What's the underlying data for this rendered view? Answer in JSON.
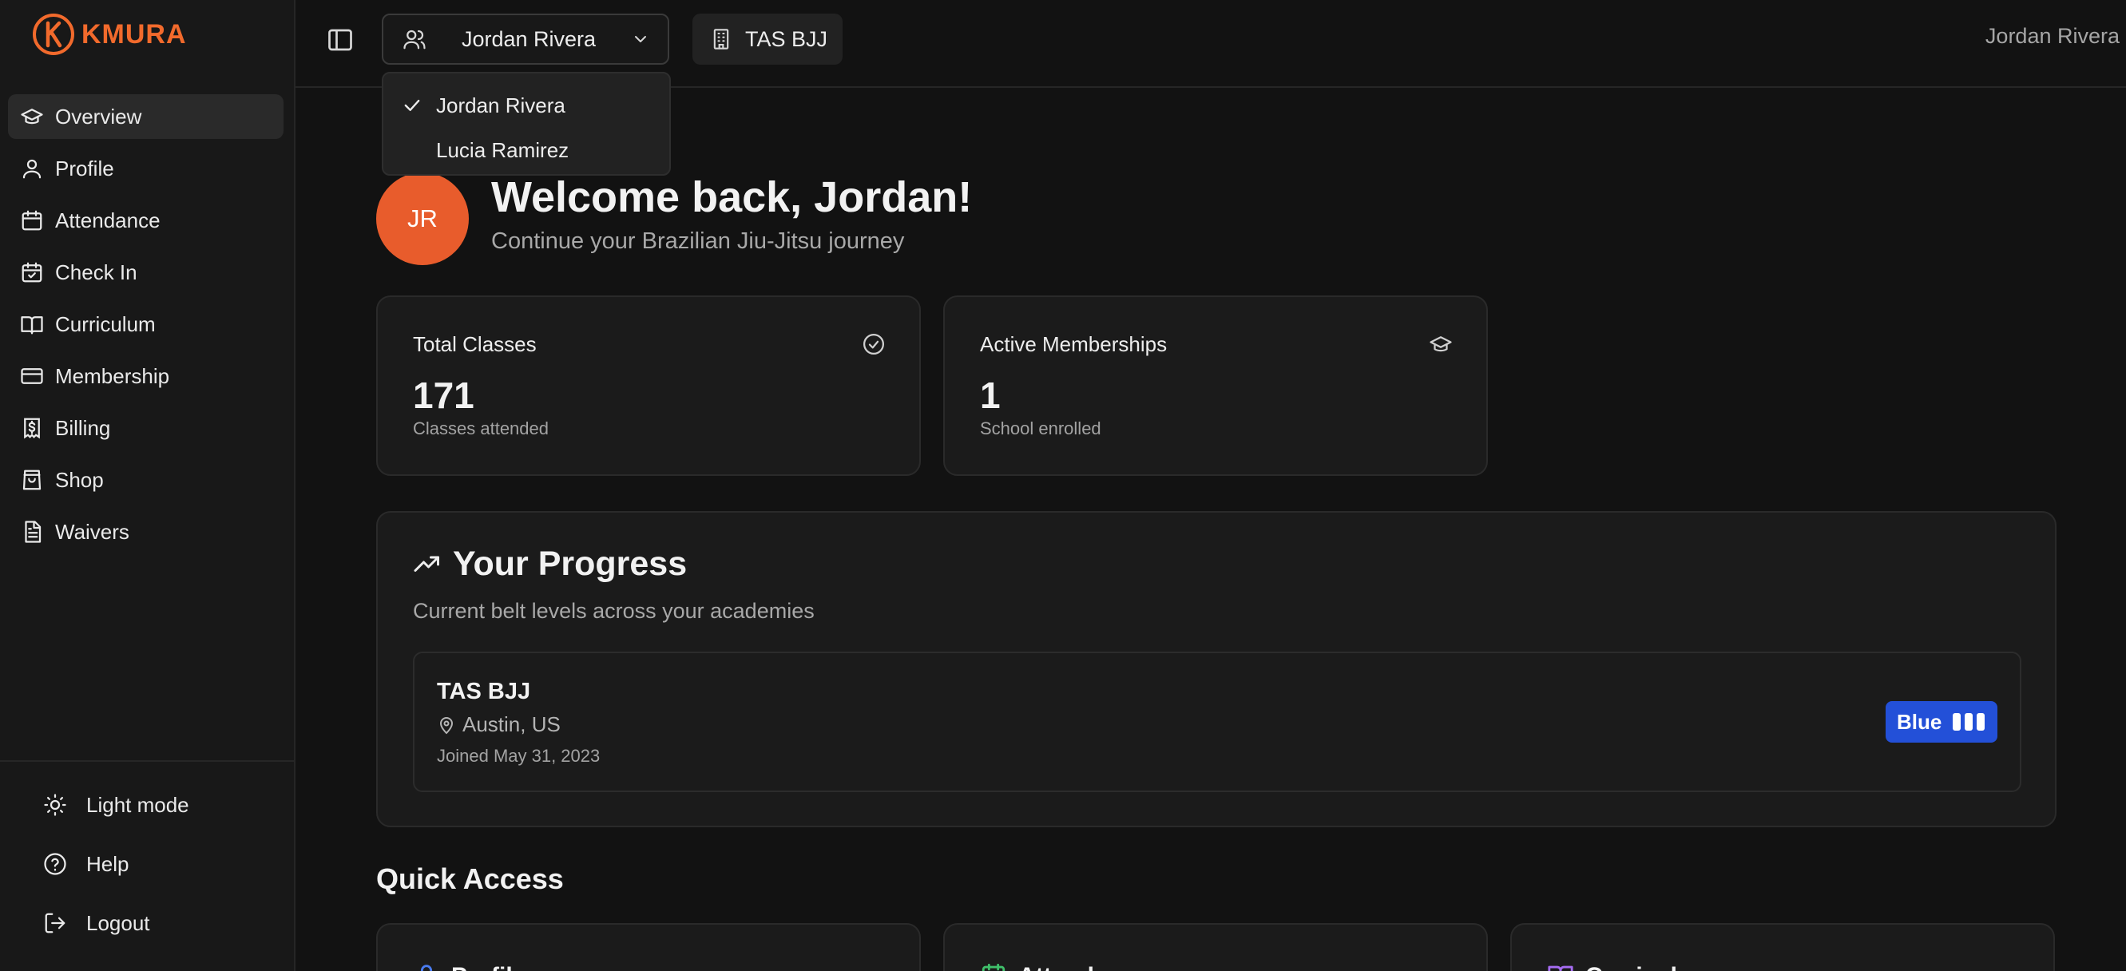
{
  "brand": {
    "name": "KMURA",
    "accent": "#f26a2c"
  },
  "sidebar": {
    "items": [
      {
        "label": "Overview",
        "icon": "graduation-cap-icon",
        "active": true
      },
      {
        "label": "Profile",
        "icon": "user-icon"
      },
      {
        "label": "Attendance",
        "icon": "calendar-icon"
      },
      {
        "label": "Check In",
        "icon": "calendar-check-icon"
      },
      {
        "label": "Curriculum",
        "icon": "book-open-icon"
      },
      {
        "label": "Membership",
        "icon": "credit-card-icon"
      },
      {
        "label": "Billing",
        "icon": "receipt-dollar-icon"
      },
      {
        "label": "Shop",
        "icon": "shopping-bag-icon"
      },
      {
        "label": "Waivers",
        "icon": "file-text-icon"
      }
    ],
    "bottom": [
      {
        "label": "Light mode",
        "icon": "sun-icon"
      },
      {
        "label": "Help",
        "icon": "help-circle-icon"
      },
      {
        "label": "Logout",
        "icon": "logout-icon"
      }
    ]
  },
  "header": {
    "student_select": {
      "value": "Jordan Rivera",
      "icon": "users-icon"
    },
    "school": {
      "label": "TAS BJJ",
      "icon": "building-icon"
    },
    "user_name": "Jordan Rivera"
  },
  "dropdown": {
    "options": [
      {
        "label": "Jordan Rivera",
        "selected": true
      },
      {
        "label": "Lucia Ramirez",
        "selected": false
      }
    ]
  },
  "main": {
    "avatar_initials": "JR",
    "avatar_color": "#e85c2c",
    "welcome": "Welcome back, Jordan!",
    "subtitle": "Continue your Brazilian Jiu-Jitsu journey",
    "stats": [
      {
        "title": "Total Classes",
        "value": "171",
        "caption": "Classes attended",
        "icon": "check-circle-icon"
      },
      {
        "title": "Active Memberships",
        "value": "1",
        "caption": "School enrolled",
        "icon": "graduation-cap-icon"
      }
    ],
    "progress": {
      "title": "Your Progress",
      "description": "Current belt levels across your academies",
      "academies": [
        {
          "name": "TAS BJJ",
          "location": "Austin, US",
          "joined": "Joined May 31, 2023",
          "belt": "Blue",
          "belt_color": "#2350d8",
          "stripes": 3
        }
      ]
    },
    "quick_access": {
      "title": "Quick Access",
      "cards": [
        {
          "label": "Profile",
          "icon": "user-icon",
          "color": "#4a7cf0"
        },
        {
          "label": "Attendance",
          "icon": "calendar-icon",
          "color": "#3fbf6a"
        },
        {
          "label": "Curriculum",
          "icon": "book-open-icon",
          "color": "#a66cf2"
        }
      ]
    }
  }
}
